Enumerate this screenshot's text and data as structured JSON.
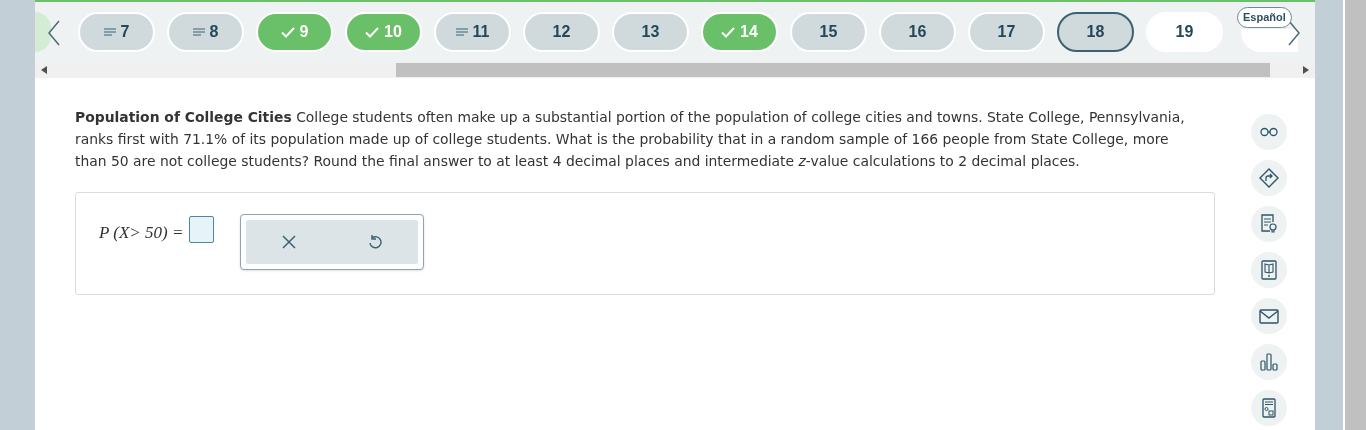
{
  "navigation": {
    "questions": [
      {
        "label": "7",
        "kind": "flagged",
        "selected": false
      },
      {
        "label": "8",
        "kind": "flagged",
        "selected": false
      },
      {
        "label": "9",
        "kind": "correct",
        "selected": false
      },
      {
        "label": "10",
        "kind": "correct",
        "selected": false
      },
      {
        "label": "11",
        "kind": "flagged",
        "selected": false
      },
      {
        "label": "12",
        "kind": "visited",
        "selected": false
      },
      {
        "label": "13",
        "kind": "visited",
        "selected": false
      },
      {
        "label": "14",
        "kind": "correct",
        "selected": false
      },
      {
        "label": "15",
        "kind": "visited",
        "selected": false
      },
      {
        "label": "16",
        "kind": "visited",
        "selected": false
      },
      {
        "label": "17",
        "kind": "visited",
        "selected": false
      },
      {
        "label": "18",
        "kind": "visited",
        "selected": true
      },
      {
        "label": "19",
        "kind": "unvisited",
        "selected": false
      }
    ],
    "language_button": "Español"
  },
  "question": {
    "title": "Population of College Cities",
    "text": "College students often make up a substantial portion of the population of college cities and towns. State College, Pennsylvania, ranks first with 71.1% of its population made up of college students. What is the probability that in a random sample of 166 people from State College, more than 50 are not college students? Round the final answer to at least 4 decimal places and intermediate *z*-value calculations to 2 decimal places."
  },
  "answer": {
    "prompt": "P (X> 50) ="
  }
}
